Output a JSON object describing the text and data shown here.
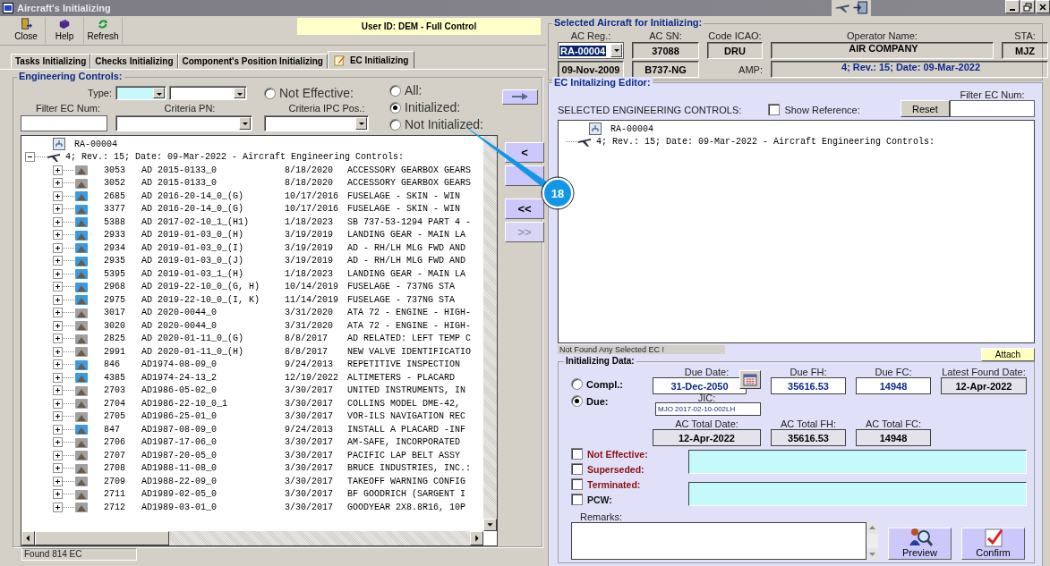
{
  "window": {
    "title": "Aircraft's Initializing"
  },
  "toolbar": [
    {
      "label": "Close",
      "kind": "exit"
    },
    {
      "label": "Help",
      "kind": "help"
    },
    {
      "label": "Refresh",
      "kind": "refresh"
    }
  ],
  "user_banner": "User ID: DEM - Full Control",
  "tabs": [
    {
      "label": "Tasks Initializing",
      "selected": false
    },
    {
      "label": "Checks Initializing",
      "selected": false
    },
    {
      "label": "Component's Position Initializing",
      "selected": false
    },
    {
      "label": "EC Initializing",
      "selected": true
    }
  ],
  "engineering_controls": {
    "title": "Engineering Controls:",
    "type_label": "Type:",
    "filter_ec_label": "Filter EC Num:",
    "criteria_pn_label": "Criteria PN:",
    "criteria_ipc_label": "Criteria IPC Pos.:",
    "not_effective": {
      "label": "Not Effective:",
      "selected": false
    },
    "view_options": [
      {
        "label": "All:",
        "selected": false
      },
      {
        "label": "Initialized:",
        "selected": true
      },
      {
        "label": "Not Initialized:",
        "selected": false
      }
    ],
    "tree": {
      "root": "RA-00004",
      "program": "4; Rev.: 15; Date: 09-Mar-2022 - Aircraft Engineering Controls:",
      "rows": [
        {
          "num": "3053",
          "code": "AD 2015-0133_0",
          "date": "8/18/2020",
          "desc": "ACCESSORY GEARBOX GEARS",
          "color": "#a0a0a0"
        },
        {
          "num": "3052",
          "code": "AD 2015-0133_0",
          "date": "8/18/2020",
          "desc": "ACCESSORY GEARBOX GEARS",
          "color": "#a0a0a0"
        },
        {
          "num": "2685",
          "code": "AD 2016-20-14_0_(G)",
          "date": "10/17/2016",
          "desc": "FUSELAGE - SKIN - WIN",
          "color": "#3b9be0"
        },
        {
          "num": "3377",
          "code": "AD 2016-20-14_0_(G)",
          "date": "10/17/2016",
          "desc": "FUSELAGE - SKIN - WIN",
          "color": "#3b9be0"
        },
        {
          "num": "5388",
          "code": "AD 2017-02-10_1_(H1)",
          "date": "1/18/2023",
          "desc": "SB 737-53-1294 PART 4 -",
          "color": "#3b9be0"
        },
        {
          "num": "2933",
          "code": "AD 2019-01-03_0_(H)",
          "date": "3/19/2019",
          "desc": "LANDING GEAR - MAIN LA",
          "color": "#3b9be0"
        },
        {
          "num": "2934",
          "code": "AD 2019-01-03_0_(I)",
          "date": "3/19/2019",
          "desc": "AD - RH/LH MLG FWD AND",
          "color": "#3b9be0"
        },
        {
          "num": "2935",
          "code": "AD 2019-01-03_0_(J)",
          "date": "3/19/2019",
          "desc": "AD - RH/LH MLG FWD AND",
          "color": "#3b9be0"
        },
        {
          "num": "5395",
          "code": "AD 2019-01-03_1_(H)",
          "date": "1/18/2023",
          "desc": "LANDING GEAR - MAIN LA",
          "color": "#3b9be0"
        },
        {
          "num": "2968",
          "code": "AD 2019-22-10_0_(G, H)",
          "date": "10/14/2019",
          "desc": "FUSELAGE - 737NG STA",
          "color": "#3b9be0"
        },
        {
          "num": "2975",
          "code": "AD 2019-22-10_0_(I, K)",
          "date": "11/14/2019",
          "desc": "FUSELAGE - 737NG STA",
          "color": "#3b9be0"
        },
        {
          "num": "3017",
          "code": "AD 2020-0044_0",
          "date": "3/31/2020",
          "desc": "ATA 72 - ENGINE - HIGH-",
          "color": "#a0a0a0"
        },
        {
          "num": "3020",
          "code": "AD 2020-0044_0",
          "date": "3/31/2020",
          "desc": "ATA 72 - ENGINE - HIGH-",
          "color": "#a0a0a0"
        },
        {
          "num": "2825",
          "code": "AD 2020-01-11_0_(G)",
          "date": "8/8/2017",
          "desc": "AD RELATED: LEFT TEMP C",
          "color": "#a0a0a0"
        },
        {
          "num": "2991",
          "code": "AD 2020-01-11_0_(H)",
          "date": "8/8/2017",
          "desc": "NEW VALVE IDENTIFICATIO",
          "color": "#a0a0a0"
        },
        {
          "num": "846",
          "code": "AD1974-08-09_0",
          "date": "9/24/2013",
          "desc": "REPETITIVE INSPECTION",
          "color": "#3b9be0"
        },
        {
          "num": "4385",
          "code": "AD1974-24-13_2",
          "date": "12/19/2022",
          "desc": "ALTIMETERS - PLACARD",
          "color": "#3b9be0"
        },
        {
          "num": "2703",
          "code": "AD1986-05-02_0",
          "date": "3/30/2017",
          "desc": "UNITED INSTRUMENTS, IN",
          "color": "#a0a0a0"
        },
        {
          "num": "2704",
          "code": "AD1986-22-10_0_1",
          "date": "3/30/2017",
          "desc": "COLLINS MODEL DME-42,",
          "color": "#a0a0a0"
        },
        {
          "num": "2705",
          "code": "AD1986-25-01_0",
          "date": "3/30/2017",
          "desc": "VOR-ILS NAVIGATION REC",
          "color": "#a0a0a0"
        },
        {
          "num": "847",
          "code": "AD1987-08-09_0",
          "date": "9/24/2013",
          "desc": "INSTALL A PLACARD -INF",
          "color": "#3b9be0"
        },
        {
          "num": "2706",
          "code": "AD1987-17-06_0",
          "date": "3/30/2017",
          "desc": "AM-SAFE, INCORPORATED",
          "color": "#a0a0a0"
        },
        {
          "num": "2707",
          "code": "AD1987-20-05_0",
          "date": "3/30/2017",
          "desc": "PACIFIC LAP BELT ASSY",
          "color": "#a0a0a0"
        },
        {
          "num": "2708",
          "code": "AD1988-11-08_0",
          "date": "3/30/2017",
          "desc": "BRUCE INDUSTRIES, INC.:",
          "color": "#a0a0a0"
        },
        {
          "num": "2709",
          "code": "AD1988-22-09_0",
          "date": "3/30/2017",
          "desc": "TAKEOFF WARNING CONFIG",
          "color": "#a0a0a0"
        },
        {
          "num": "2711",
          "code": "AD1989-02-05_0",
          "date": "3/30/2017",
          "desc": "BF GOODRICH (SARGENT I",
          "color": "#a0a0a0"
        },
        {
          "num": "2712",
          "code": "AD1989-03-01_0",
          "date": "3/30/2017",
          "desc": "GOODYEAR 2X8.8R16, 10P",
          "color": "#a0a0a0"
        }
      ]
    },
    "status": "Found 814 EC"
  },
  "transfer_buttons": [
    {
      "label": "<",
      "disabled": false
    },
    {
      "disabled": false
    },
    {
      "label": "<<",
      "disabled": false
    },
    {
      "label": ">>",
      "disabled": true
    }
  ],
  "selected_aircraft": {
    "title": "Selected Aircraft for Initializing:",
    "ac_reg_label": "AC Reg.:",
    "ac_reg": "RA-00004",
    "manufacture_date": "09-Nov-2009",
    "ac_sn_label": "AC SN:",
    "ac_sn": "37088",
    "model": "B737-NG",
    "code_icao_label": "Code ICAO:",
    "code_icao": "DRU",
    "operator_label": "Operator Name:",
    "operator": "AIR COMPANY",
    "sta_label": "STA:",
    "sta": "MJZ",
    "amp_label": "AMP:",
    "amp": "4; Rev.: 15; Date: 09-Mar-2022"
  },
  "editor": {
    "title": "EC Initalizing Editor:",
    "selected_label": "SELECTED ENGINEERING CONTROLS:",
    "show_reference": {
      "label": "Show Reference:",
      "checked": false
    },
    "reset": "Reset",
    "filter_label": "Filter EC Num:",
    "tree": {
      "root": "RA-00004",
      "program": "4; Rev.: 15; Date: 09-Mar-2022 - Aircraft Engineering Controls:"
    },
    "status": "Not Found Any Selected EC !",
    "attach": "Attach"
  },
  "initializing_data": {
    "title": "Initializing Data:",
    "mode_options": [
      {
        "label": "Compl.:",
        "selected": false
      },
      {
        "label": "Due:",
        "selected": true
      }
    ],
    "due_date_label": "Due Date:",
    "due_date": "31-Dec-2050",
    "due_fh_label": "Due FH:",
    "due_fh": "35616.53",
    "due_fc_label": "Due FC:",
    "due_fc": "14948",
    "latest_found_label": "Latest Found Date:",
    "latest_found": "12-Apr-2022",
    "jic_label": "JIC:",
    "jic": "MJO 2017-02-10-002LH",
    "ac_total_date_label": "AC Total Date:",
    "ac_total_date": "12-Apr-2022",
    "ac_total_fh_label": "AC Total FH:",
    "ac_total_fh": "35616.53",
    "ac_total_fc_label": "AC Total FC:",
    "ac_total_fc": "14948",
    "flags": [
      {
        "label": "Not Effective:",
        "checked": false
      },
      {
        "label": "Superseded:",
        "checked": false
      },
      {
        "label": "Terminated:",
        "checked": false
      },
      {
        "label": "PCW:",
        "checked": false
      }
    ],
    "remarks_label": "Remarks:",
    "preview": "Preview",
    "confirm": "Confirm"
  },
  "callout": {
    "label": "18"
  }
}
